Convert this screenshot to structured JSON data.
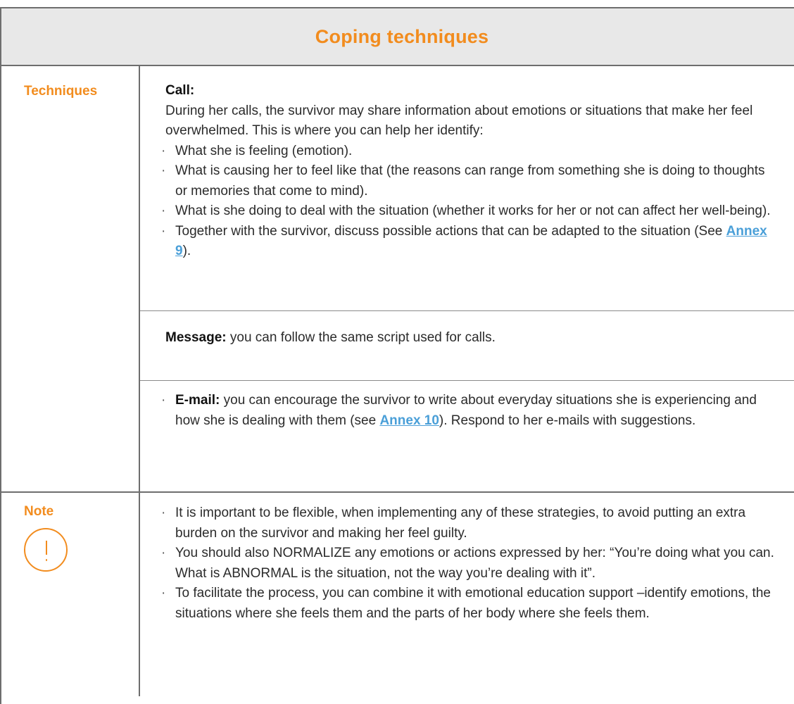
{
  "header": {
    "title": "Coping techniques"
  },
  "rows": {
    "techniques": {
      "label": "Techniques",
      "call": {
        "heading": "Call:",
        "intro": "During her calls, the survivor may share information about emotions or situations that make her feel overwhelmed. This is where you can help her identify:",
        "bullets": [
          "What she is feeling (emotion).",
          "What is causing her to feel like that (the reasons can range from something she is doing to thoughts or memories that come to mind).",
          "What is she doing to deal with the situation (whether it works for her or not can affect her well-being).",
          "Together with the survivor, discuss possible actions that can be adapted to the situation (See "
        ],
        "bullet4_link": "Annex 9",
        "bullet4_end": ")."
      },
      "message": {
        "heading": "Message:",
        "text": " you can follow the same script used for calls."
      },
      "email": {
        "heading": "E-mail:",
        "text": " you can encourage the survivor to write about everyday situations she is experiencing and how she is dealing with them (see ",
        "link": "Annex 10",
        "end": "). Respond to her e-mails with suggestions."
      }
    },
    "note": {
      "label": "Note",
      "icon": "exclamation-circle-icon",
      "bullets": [
        "It is important to be flexible, when implementing any of these strategies, to avoid putting an extra burden on the survivor and making her feel guilty.",
        "You should also NORMALIZE any emotions or actions expressed by her: “You’re doing what you can. What is ABNORMAL is the situation, not the way you’re dealing with it”.",
        "To facilitate the process, you can combine it with emotional education support –identify emotions, the situations where she feels them and the parts of her body where she feels them."
      ]
    }
  },
  "colors": {
    "accent": "#f28c1e",
    "link": "#4a9fd8",
    "header_bg": "#e8e8e8",
    "border": "#6e6e6e"
  }
}
